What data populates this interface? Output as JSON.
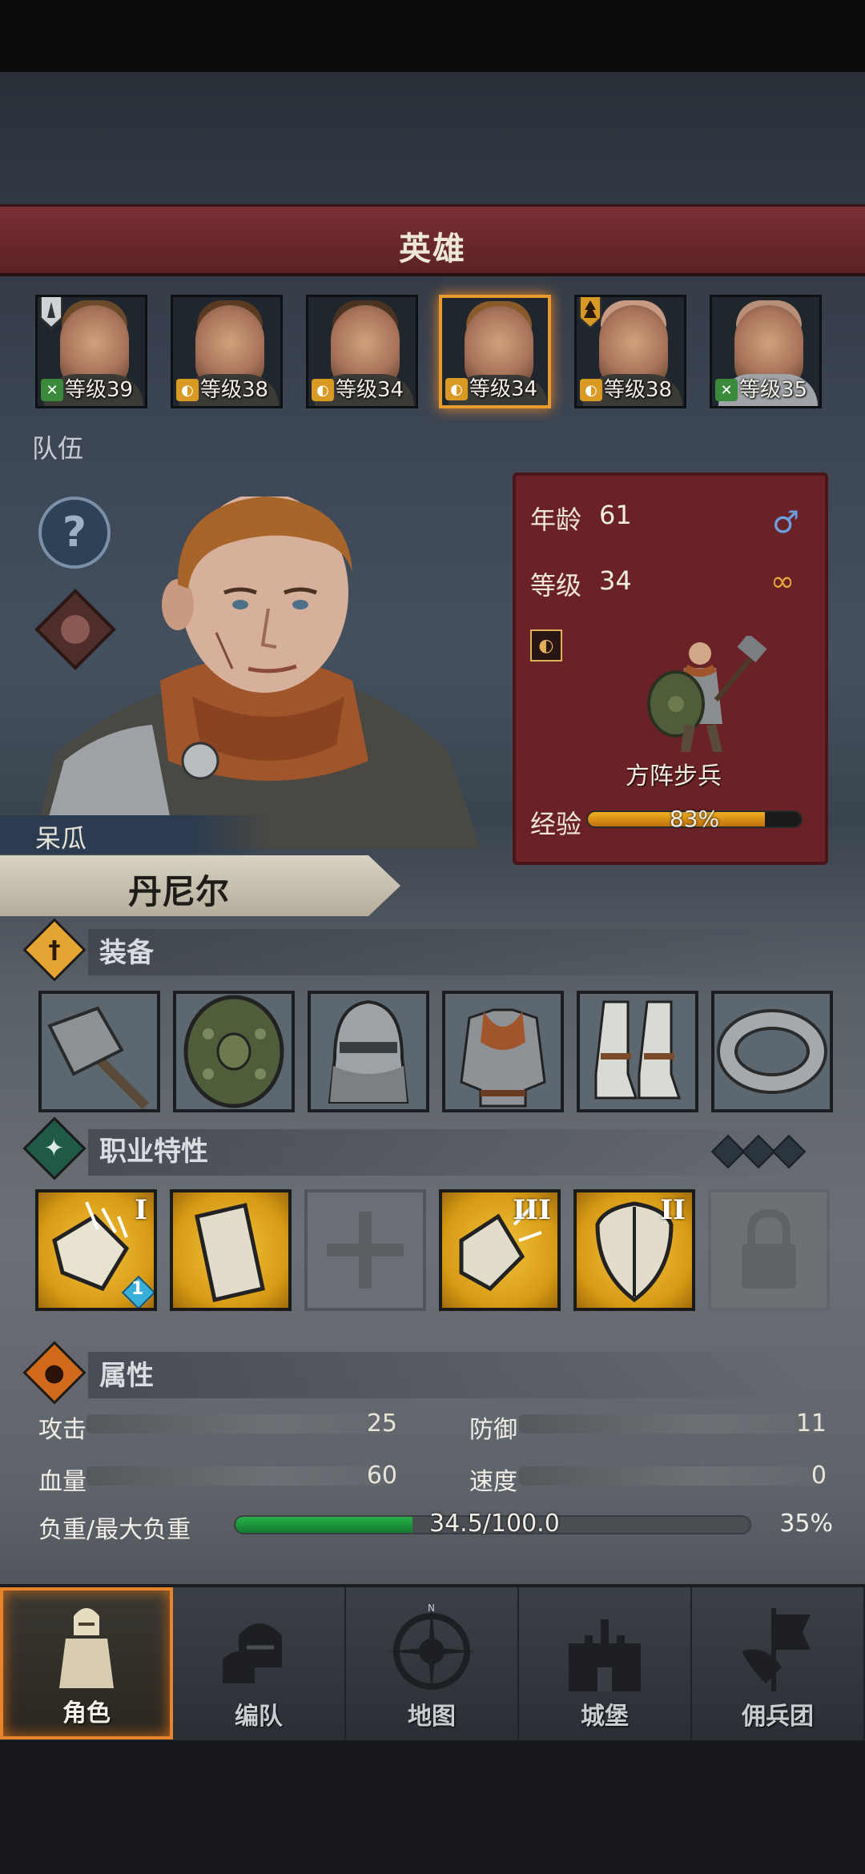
{
  "header": {
    "title": "英雄"
  },
  "heroes": [
    {
      "level": "等级39",
      "badge": "green",
      "flag": true,
      "selected": false
    },
    {
      "level": "等级38",
      "badge": "gold",
      "flag": false,
      "selected": false
    },
    {
      "level": "等级34",
      "badge": "gold",
      "flag": false,
      "selected": false
    },
    {
      "level": "等级34",
      "badge": "gold",
      "flag": false,
      "selected": true
    },
    {
      "level": "等级38",
      "badge": "gold",
      "flag": true,
      "selected": false
    },
    {
      "level": "等级35",
      "badge": "green",
      "flag": false,
      "selected": false
    }
  ],
  "team_label": "队伍",
  "hero": {
    "nickname": "呆瓜",
    "name": "丹尼尔",
    "age_label": "年龄",
    "age": "61",
    "level_label": "等级",
    "level": "34",
    "class_name": "方阵步兵",
    "exp_label": "经验",
    "exp_percent_text": "83%",
    "exp_fraction": 0.83
  },
  "sections": {
    "equipment": "装备",
    "traits": "职业特性",
    "attributes": "属性"
  },
  "equipment": [
    "hammer-icon",
    "shield-icon",
    "helmet-icon",
    "armor-icon",
    "boots-icon",
    "ring-icon"
  ],
  "skills": [
    {
      "state": "gold",
      "rank": "I",
      "icon": "shield-bash-icon",
      "extra": "1"
    },
    {
      "state": "gold",
      "rank": "",
      "icon": "tower-shield-icon",
      "extra": ""
    },
    {
      "state": "empty",
      "rank": "",
      "icon": "cross-icon",
      "extra": ""
    },
    {
      "state": "gold",
      "rank": "III",
      "icon": "shield-break-icon",
      "extra": ""
    },
    {
      "state": "gold",
      "rank": "II",
      "icon": "kite-shield-icon",
      "extra": ""
    },
    {
      "state": "locked",
      "rank": "",
      "icon": "lock-icon",
      "extra": ""
    }
  ],
  "attributes": {
    "attack_label": "攻击",
    "attack": "25",
    "defense_label": "防御",
    "defense": "11",
    "hp_label": "血量",
    "hp": "60",
    "speed_label": "速度",
    "speed": "0",
    "load_label": "负重/最大负重",
    "load_text": "34.5/100.0",
    "load_pct": "35%",
    "load_fraction": 0.345
  },
  "nav": [
    {
      "label": "角色",
      "icon": "knight-icon",
      "active": true
    },
    {
      "label": "编队",
      "icon": "helmet-group-icon",
      "active": false
    },
    {
      "label": "地图",
      "icon": "compass-icon",
      "active": false
    },
    {
      "label": "城堡",
      "icon": "castle-icon",
      "active": false
    },
    {
      "label": "佣兵团",
      "icon": "banner-icon",
      "active": false
    }
  ],
  "colors": {
    "header": "#6b2227",
    "accent_orange": "#e8852a",
    "gold_skill": "#d79a14",
    "load_green": "#29b04a",
    "exp_orange": "#f0b020"
  }
}
